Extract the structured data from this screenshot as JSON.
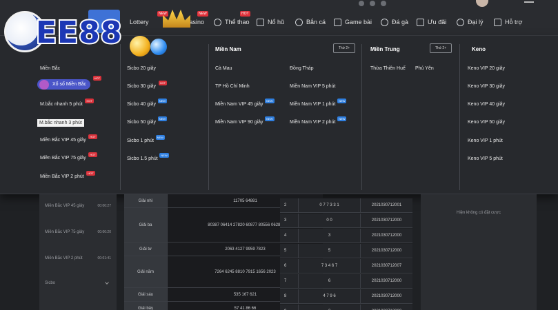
{
  "brand": {
    "logo_text": "EE88",
    "logo_badge_text": "88"
  },
  "topnav": {
    "items": [
      {
        "label": "Lottery",
        "icon": "lottery-icon"
      },
      {
        "label": "Casino",
        "icon": "casino-icon"
      },
      {
        "label": "Thể thao",
        "icon": "sports-icon"
      },
      {
        "label": "Nổ hũ",
        "icon": "slot-icon"
      },
      {
        "label": "Bắn cá",
        "icon": "fish-icon"
      },
      {
        "label": "Game bài",
        "icon": "cards-icon"
      },
      {
        "label": "Đá gà",
        "icon": "cockfight-icon"
      },
      {
        "label": "Ưu đãi",
        "icon": "promo-icon"
      },
      {
        "label": "Đại lý",
        "icon": "agent-icon"
      },
      {
        "label": "Hỗ trợ",
        "icon": "support-icon"
      }
    ]
  },
  "dropdown": {
    "col1": [
      {
        "label": "Miền Bắc",
        "tag": ""
      },
      {
        "label": "Xổ số Miền Bắc",
        "tag": "HOT"
      },
      {
        "label": "M.bắc nhanh 5 phút",
        "tag": "HOT"
      },
      {
        "label": "M.bắc nhanh 3 phút",
        "tag": ""
      },
      {
        "label": "Miền Bắc VIP 45 giây",
        "tag": "HOT"
      },
      {
        "label": "Miền Bắc VIP 75 giây",
        "tag": "HOT"
      },
      {
        "label": "Miền Bắc VIP 2 phút",
        "tag": "HOT"
      }
    ],
    "col2": [
      {
        "label": "Sicbo 20 giây",
        "tag": ""
      },
      {
        "label": "Sicbo 30 giây",
        "tag": "HOT"
      },
      {
        "label": "Sicbo 40 giây",
        "tag": "NEW"
      },
      {
        "label": "Sicbo 50 giây",
        "tag": "NEW"
      },
      {
        "label": "Sicbo 1 phút",
        "tag": "NEW"
      },
      {
        "label": "Sicbo 1.5 phút",
        "tag": "NEW"
      }
    ],
    "mien_nam": {
      "title": "Miền Nam",
      "more": "Thứ 2+",
      "left": [
        {
          "label": "Cà Mau",
          "tag": ""
        },
        {
          "label": "TP Hồ Chí Minh",
          "tag": ""
        },
        {
          "label": "Miền Nam VIP 45 giây",
          "tag": "NEW"
        },
        {
          "label": "Miền Nam VIP 90 giây",
          "tag": "NEW"
        }
      ],
      "right": [
        {
          "label": "Đồng Tháp",
          "tag": ""
        },
        {
          "label": "Miền Nam VIP 5 phút",
          "tag": ""
        },
        {
          "label": "Miền Nam VIP 1 phút",
          "tag": "NEW"
        },
        {
          "label": "Miền Nam VIP 2 phút",
          "tag": "NEW"
        }
      ]
    },
    "mien_trung": {
      "title": "Miền Trung",
      "more": "Thứ 2+",
      "items": [
        {
          "label": "Thừa Thiên Huế"
        },
        {
          "label": "Phú Yên"
        }
      ]
    },
    "keno": {
      "title": "Keno",
      "items": [
        {
          "label": "Keno VIP 20 giây"
        },
        {
          "label": "Keno VIP 30 giây"
        },
        {
          "label": "Keno VIP 40 giây"
        },
        {
          "label": "Keno VIP 50 giây"
        },
        {
          "label": "Keno VIP 1 phút"
        },
        {
          "label": "Keno VIP 5 phút"
        }
      ]
    }
  },
  "left_list": {
    "rows": [
      {
        "label": "Miền Bắc VIP 45 giây",
        "time": "00:00:27"
      },
      {
        "label": "Miền Bắc VIP 75 giây",
        "time": "00:00:20"
      },
      {
        "label": "Miền Bắc VIP 2 phút",
        "time": "00:01:41"
      }
    ],
    "select_label": "Sicbo"
  },
  "results": {
    "rows": [
      {
        "label": "Giải nhì",
        "value": "11705 64881"
      },
      {
        "label": "Giải ba",
        "value": "80387 06414 27820 60877 80556 06287"
      },
      {
        "label": "Giải tư",
        "value": "2063 4127 9959 7823"
      },
      {
        "label": "Giải năm",
        "value": "7264 6245 8810 7915 1656 2023"
      },
      {
        "label": "Giải sáu",
        "value": "535 167 621"
      },
      {
        "label": "Giải bảy",
        "value": "57 41 86 66"
      }
    ]
  },
  "side_table": {
    "rows": [
      {
        "n": "2",
        "v": "0 7 7 3 3 1",
        "id": "2021030712001"
      },
      {
        "n": "3",
        "v": "0 0",
        "id": "2021030712000"
      },
      {
        "n": "4",
        "v": "3",
        "id": "2021030712000"
      },
      {
        "n": "5",
        "v": "5",
        "id": "2021030712000"
      },
      {
        "n": "6",
        "v": "7 3 4 6 7",
        "id": "2021030712007"
      },
      {
        "n": "7",
        "v": "6",
        "id": "2021030712000"
      },
      {
        "n": "8",
        "v": "4 7 9 6",
        "id": "2021030712000"
      },
      {
        "n": "9",
        "v": "2",
        "id": "2021030712000"
      }
    ]
  },
  "right_box": {
    "message": "Hiện không có đặt cược"
  }
}
